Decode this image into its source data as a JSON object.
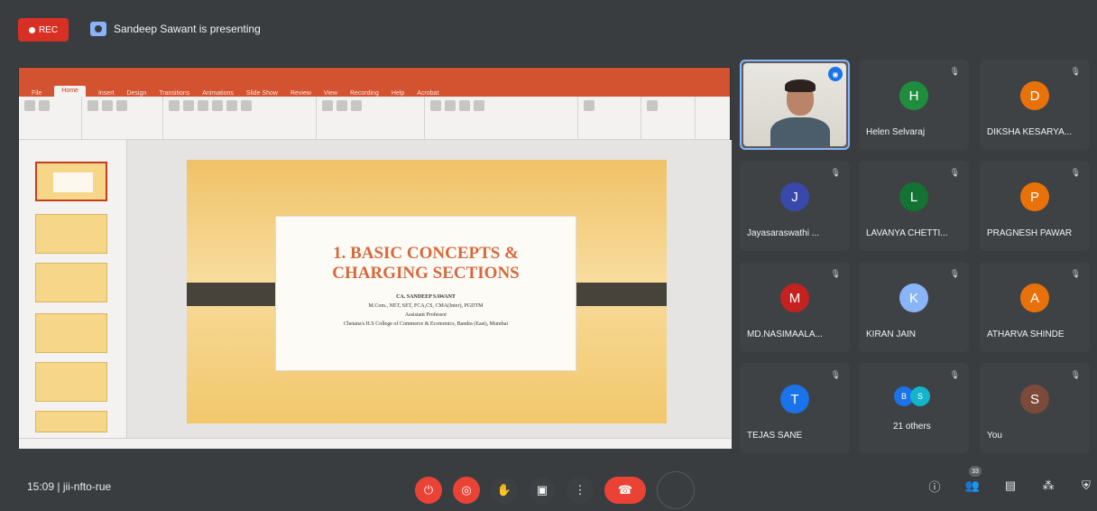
{
  "topbar": {
    "rec_label": "REC",
    "presenter_text": "Sandeep Sawant is presenting"
  },
  "presentation": {
    "ribbon_tabs": [
      "File",
      "Home",
      "Insert",
      "Design",
      "Transitions",
      "Animations",
      "Slide Show",
      "Review",
      "View",
      "Recording",
      "Help",
      "Acrobat"
    ],
    "active_tab": "Home",
    "slide": {
      "title_line1": "1. BASIC CONCEPTS &",
      "title_line2": "CHARGING SECTIONS",
      "author": "CA. SANDEEP SAWANT",
      "qualifications": "M.Com., NET, SET, FCA,CS, CMA(Inter), PGDTM",
      "role": "Assistant Professor",
      "institution": "Chetana's H.S College of Commerce & Economics, Bandra (East), Mumbai"
    }
  },
  "participants": [
    {
      "name": "",
      "initial": "",
      "self_video": true,
      "speaking": true
    },
    {
      "name": "Helen Selvaraj",
      "initial": "H",
      "color": "#1e8e3e"
    },
    {
      "name": "DIKSHA KESARYA...",
      "initial": "D",
      "color": "#e8710a"
    },
    {
      "name": "Jayasaraswathi ...",
      "initial": "J",
      "color": "#3949ab"
    },
    {
      "name": "LAVANYA CHETTI...",
      "initial": "L",
      "color": "#137333"
    },
    {
      "name": "PRAGNESH PAWAR",
      "initial": "P",
      "color": "#e8710a"
    },
    {
      "name": "MD.NASIMAALA...",
      "initial": "M",
      "color": "#c5221f"
    },
    {
      "name": "KIRAN JAIN",
      "initial": "K",
      "color": "#8ab4f8"
    },
    {
      "name": "ATHARVA SHINDE",
      "initial": "A",
      "color": "#e8710a"
    },
    {
      "name": "TEJAS SANE",
      "initial": "T",
      "color": "#1a73e8"
    },
    {
      "name": "21 others",
      "initials": [
        "B",
        "S"
      ],
      "colors": [
        "#1a73e8",
        "#12b5cb"
      ]
    },
    {
      "name": "You",
      "initial": "S",
      "color": "#7c4a3a"
    }
  ],
  "bottom": {
    "time_meeting": "15:09 | jii-nfto-rue",
    "participant_count": "33"
  },
  "icons": {
    "mic": "mic-off-icon",
    "camera": "camera-off-icon",
    "hand": "raise-hand-icon",
    "present": "present-icon",
    "more": "more-icon",
    "end": "end-call-icon",
    "info": "info-icon",
    "people": "people-icon",
    "chat": "chat-icon",
    "activities": "activities-icon",
    "security": "host-controls-icon"
  }
}
